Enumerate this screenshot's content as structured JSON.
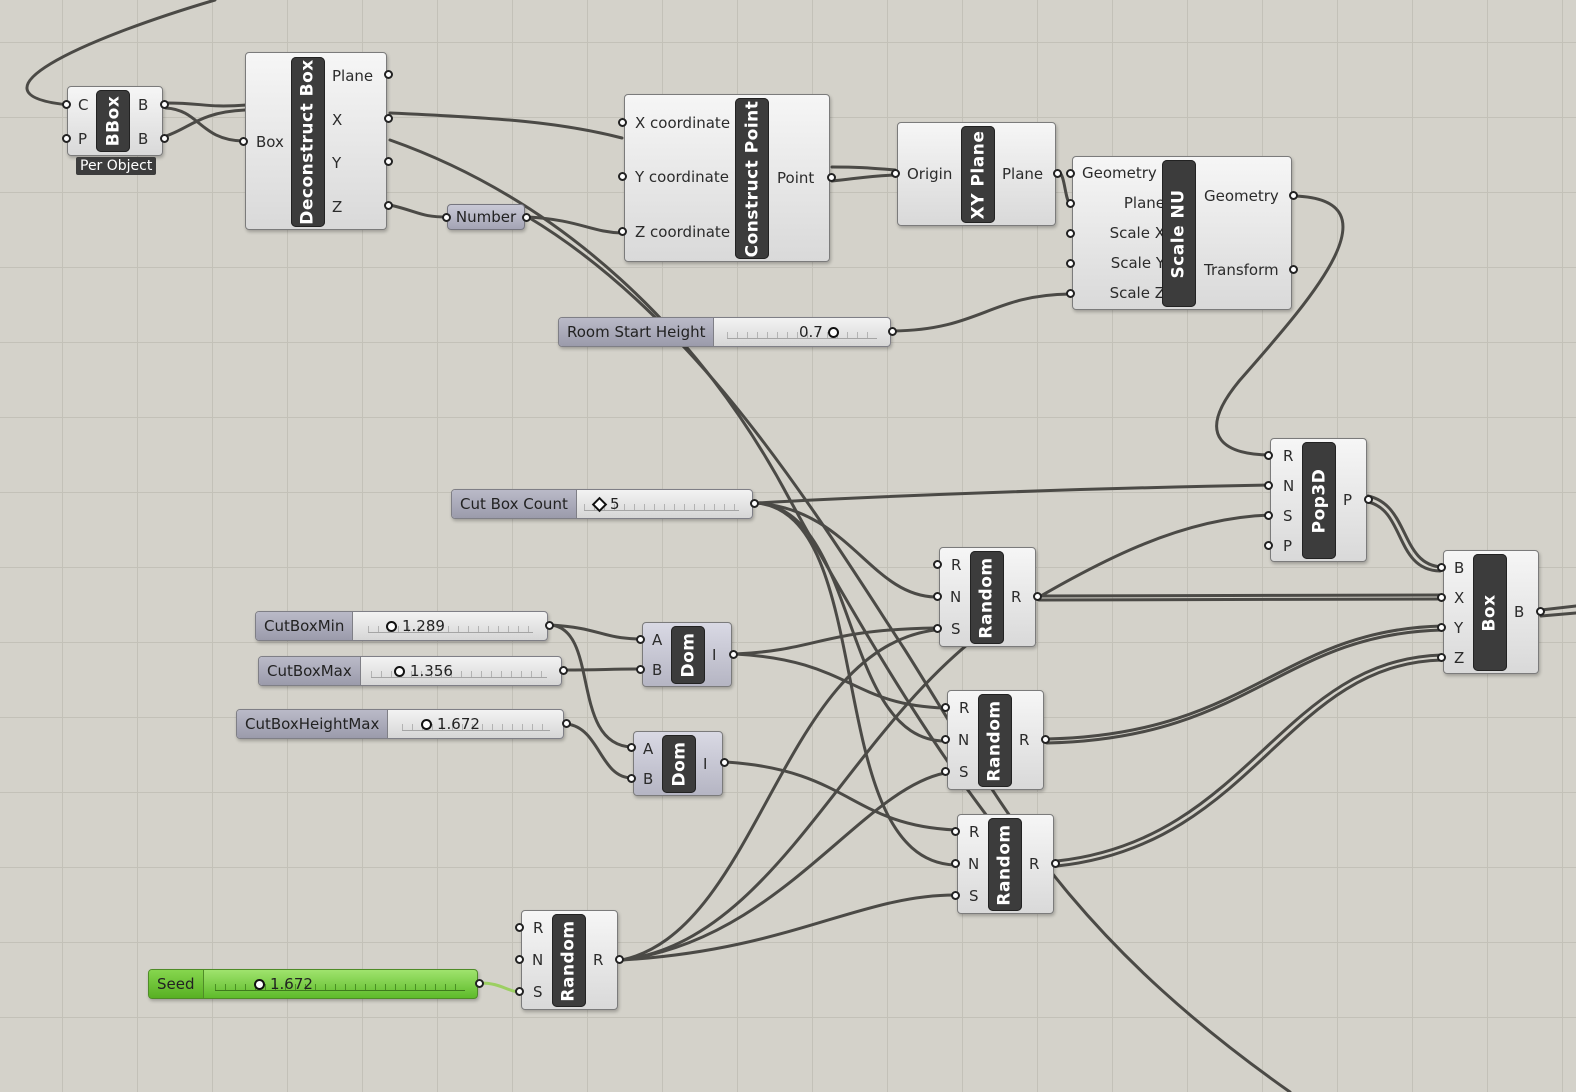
{
  "canvas": {
    "grid_color": "#c3c1b8",
    "background_color": "#d4d2ca",
    "wire_color": "#4b4a46",
    "active_slider_color": "#6fc43a"
  },
  "components": {
    "bbox": {
      "title": "BBox",
      "inputs": [
        "C",
        "P"
      ],
      "outputs": [
        "B",
        "B"
      ],
      "tag": "Per Object"
    },
    "deconstruct_box": {
      "title": "Deconstruct Box",
      "inputs": [
        "Box"
      ],
      "outputs": [
        "Plane",
        "X",
        "Y",
        "Z"
      ]
    },
    "number": {
      "label": "Number"
    },
    "construct_point": {
      "title": "Construct Point",
      "inputs": [
        "X coordinate",
        "Y coordinate",
        "Z coordinate"
      ],
      "outputs": [
        "Point"
      ]
    },
    "xy_plane": {
      "title": "XY Plane",
      "inputs": [
        "Origin"
      ],
      "outputs": [
        "Plane"
      ]
    },
    "scale_nu": {
      "title": "Scale NU",
      "inputs": [
        "Geometry",
        "Plane",
        "Scale X",
        "Scale Y",
        "Scale Z"
      ],
      "outputs": [
        "Geometry",
        "Transform"
      ]
    },
    "pop3d": {
      "title": "Pop3D",
      "inputs": [
        "R",
        "N",
        "S",
        "P"
      ],
      "outputs": [
        "P"
      ]
    },
    "box": {
      "title": "Box",
      "inputs": [
        "B",
        "X",
        "Y",
        "Z"
      ],
      "outputs": [
        "B"
      ]
    },
    "dom1": {
      "title": "Dom",
      "inputs": [
        "A",
        "B"
      ],
      "outputs": [
        "I"
      ]
    },
    "dom2": {
      "title": "Dom",
      "inputs": [
        "A",
        "B"
      ],
      "outputs": [
        "I"
      ]
    },
    "random1": {
      "title": "Random",
      "inputs": [
        "R",
        "N",
        "S"
      ],
      "outputs": [
        "R"
      ]
    },
    "random2": {
      "title": "Random",
      "inputs": [
        "R",
        "N",
        "S"
      ],
      "outputs": [
        "R"
      ]
    },
    "random3": {
      "title": "Random",
      "inputs": [
        "R",
        "N",
        "S"
      ],
      "outputs": [
        "R"
      ]
    },
    "random4": {
      "title": "Random",
      "inputs": [
        "R",
        "N",
        "S"
      ],
      "outputs": [
        "R"
      ]
    }
  },
  "sliders": {
    "room_start_height": {
      "label": "Room Start Height",
      "value": "0.7"
    },
    "cut_box_count": {
      "label": "Cut Box Count",
      "value": "5"
    },
    "cut_box_min": {
      "label": "CutBoxMin",
      "value": "1.289"
    },
    "cut_box_max": {
      "label": "CutBoxMax",
      "value": "1.356"
    },
    "cut_box_height_max": {
      "label": "CutBoxHeightMax",
      "value": "1.672"
    },
    "seed": {
      "label": "Seed",
      "value": "1.672"
    }
  }
}
